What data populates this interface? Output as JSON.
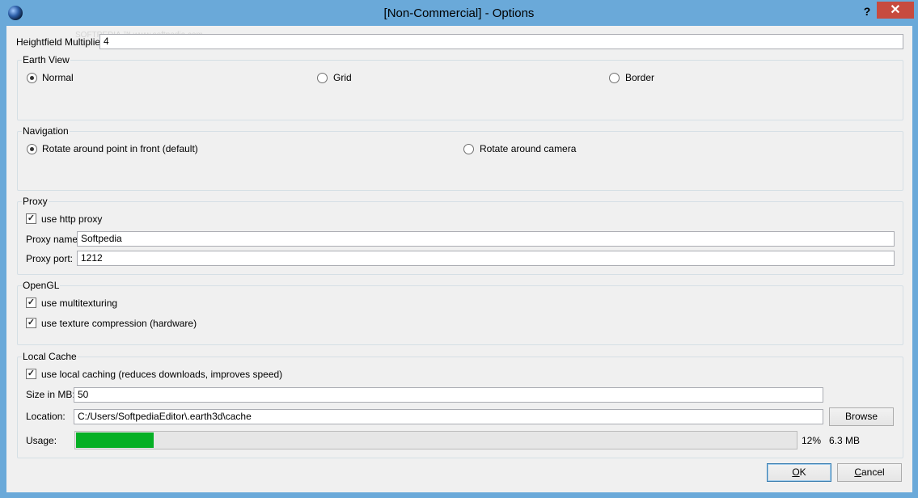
{
  "window": {
    "title": "[Non-Commercial] - Options",
    "help": "?",
    "close": "✕"
  },
  "watermark": "SOFTPEDIA ™  www.softpedia.com",
  "heightfield": {
    "label": "Heightfield Multiplier:",
    "value": "4"
  },
  "earth_view": {
    "legend": "Earth View",
    "options": [
      {
        "label": "Normal",
        "selected": true
      },
      {
        "label": "Grid",
        "selected": false
      },
      {
        "label": "Border",
        "selected": false
      }
    ]
  },
  "navigation": {
    "legend": "Navigation",
    "options": [
      {
        "label": "Rotate around point in front (default)",
        "selected": true
      },
      {
        "label": "Rotate around camera",
        "selected": false
      }
    ]
  },
  "proxy": {
    "legend": "Proxy",
    "use_label": "use http proxy",
    "use_checked": true,
    "name_label": "Proxy name:",
    "name_value": "Softpedia",
    "port_label": "Proxy port:",
    "port_value": "1212"
  },
  "opengl": {
    "legend": "OpenGL",
    "multitexturing_label": "use multitexturing",
    "multitexturing_checked": true,
    "compression_label": "use texture compression (hardware)",
    "compression_checked": true
  },
  "cache": {
    "legend": "Local Cache",
    "use_label": "use local caching (reduces downloads, improves speed)",
    "use_checked": true,
    "size_label": "Size in MB:",
    "size_value": "50",
    "location_label": "Location:",
    "location_value": "C:/Users/SoftpediaEditor\\.earth3d\\cache",
    "browse_label": "Browse",
    "usage_label": "Usage:",
    "usage_fraction": 0.12,
    "usage_percent": "12%",
    "usage_size": "6.3 MB",
    "bar_color": "#06b025"
  },
  "buttons": {
    "ok": "OK",
    "cancel": "Cancel"
  },
  "colors": {
    "titlebar": "#6aa9d9",
    "close": "#c74b3f"
  }
}
